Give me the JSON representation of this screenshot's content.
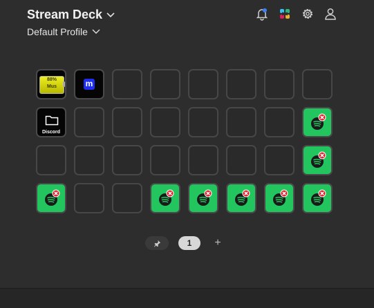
{
  "app": {
    "title": "Stream Deck",
    "profile": "Default Profile"
  },
  "header_icons": [
    "bell-notification-icon",
    "slack-icon",
    "gear-icon",
    "account-icon"
  ],
  "grid": {
    "rows": 4,
    "cols": 8,
    "keys": [
      {
        "type": "battery"
      },
      {
        "type": "m-logo"
      },
      {
        "type": "empty"
      },
      {
        "type": "empty"
      },
      {
        "type": "empty"
      },
      {
        "type": "empty"
      },
      {
        "type": "empty"
      },
      {
        "type": "empty"
      },
      {
        "type": "folder",
        "label": "Discord"
      },
      {
        "type": "empty"
      },
      {
        "type": "empty"
      },
      {
        "type": "empty"
      },
      {
        "type": "empty"
      },
      {
        "type": "empty"
      },
      {
        "type": "empty"
      },
      {
        "type": "spotify-error"
      },
      {
        "type": "empty"
      },
      {
        "type": "empty"
      },
      {
        "type": "empty"
      },
      {
        "type": "empty"
      },
      {
        "type": "empty"
      },
      {
        "type": "empty"
      },
      {
        "type": "empty"
      },
      {
        "type": "spotify-error"
      },
      {
        "type": "spotify-error"
      },
      {
        "type": "empty"
      },
      {
        "type": "empty"
      },
      {
        "type": "spotify-error"
      },
      {
        "type": "spotify-error"
      },
      {
        "type": "spotify-error"
      },
      {
        "type": "spotify-error"
      },
      {
        "type": "spotify-error"
      }
    ],
    "battery_text": [
      "88%",
      "Mus"
    ]
  },
  "pager": {
    "current_page": "1",
    "add_label": "+"
  },
  "colors": {
    "background": "#2d2d2d",
    "key_empty": "#2a2a2a",
    "key_green": "#22c55e",
    "error_red": "#e11d2a"
  }
}
